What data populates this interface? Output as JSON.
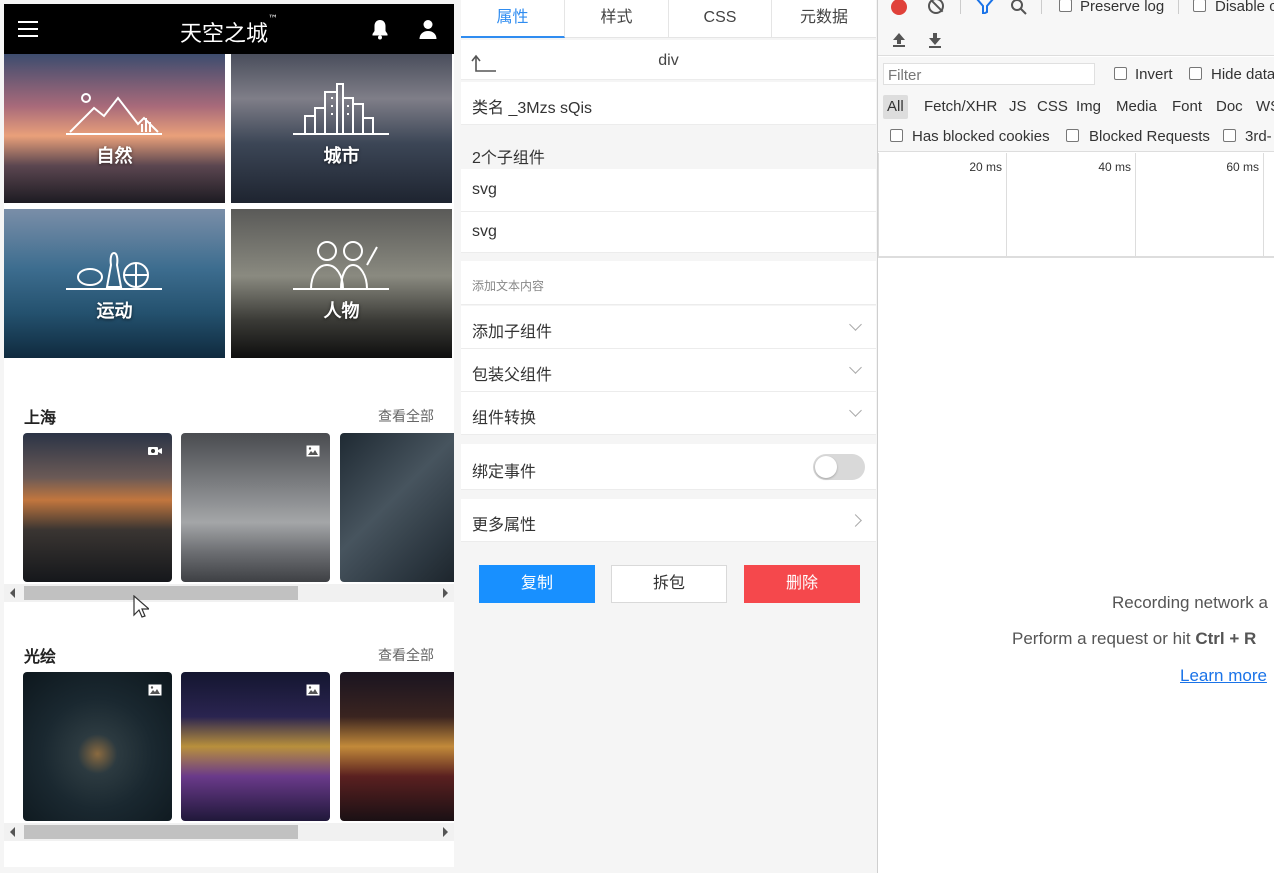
{
  "app": {
    "title": "天空之城",
    "trademark": "™",
    "categories": [
      {
        "label": "自然"
      },
      {
        "label": "城市"
      },
      {
        "label": "运动"
      },
      {
        "label": "人物"
      }
    ],
    "sections": [
      {
        "title": "上海",
        "more": "查看全部",
        "badges": [
          "video-icon",
          "image-icon"
        ]
      },
      {
        "title": "光绘",
        "more": "查看全部",
        "badges": [
          "image-icon",
          "image-icon"
        ]
      }
    ]
  },
  "props": {
    "tabs": [
      "属性",
      "样式",
      "CSS",
      "元数据"
    ],
    "active_tab": "属性",
    "tag": "div",
    "classname": "类名 _3Mzs sQis",
    "children_header": "2个子组件",
    "children": [
      "svg",
      "svg"
    ],
    "add_text": "添加文本内容",
    "add_child": "添加子组件",
    "wrap_parent": "包装父组件",
    "convert": "组件转换",
    "bind_event": "绑定事件",
    "bind_event_on": false,
    "more_props": "更多属性",
    "buttons": {
      "copy": "复制",
      "unwrap": "拆包",
      "delete": "删除"
    },
    "colors": {
      "accent": "#1890ff",
      "danger": "#f5484c"
    }
  },
  "devtools": {
    "preserve_log": "Preserve log",
    "disable_cache": "Disable c",
    "filter_placeholder": "Filter",
    "invert": "Invert",
    "hide_data": "Hide data",
    "types": [
      "All",
      "Fetch/XHR",
      "JS",
      "CSS",
      "Img",
      "Media",
      "Font",
      "Doc",
      "WS"
    ],
    "has_blocked_cookies": "Has blocked cookies",
    "blocked_requests": "Blocked Requests",
    "third_party": "3rd-",
    "ticks": [
      "20 ms",
      "40 ms",
      "60 ms"
    ],
    "empty_line1": "Recording network a",
    "empty_line2_prefix": "Perform a request or hit ",
    "empty_line2_keys": "Ctrl + R",
    "learn_more": "Learn more",
    "record_color": "#e0413a"
  }
}
